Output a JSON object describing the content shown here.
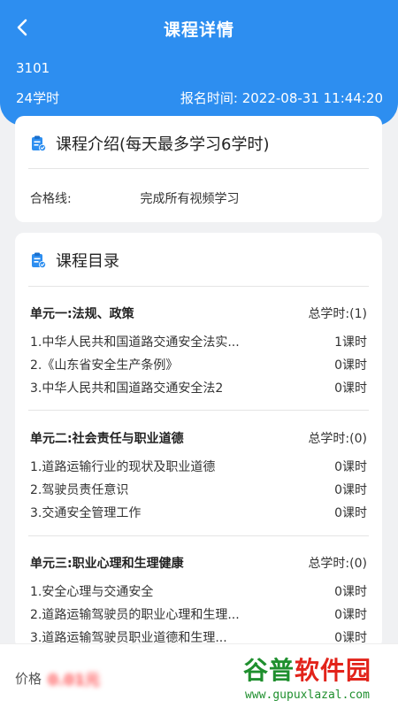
{
  "nav": {
    "title": "课程详情"
  },
  "header": {
    "course_code": "3101",
    "hours": "24学时",
    "enroll_label": "报名时间:",
    "enroll_time": "2022-08-31 11:44:20"
  },
  "intro": {
    "title": "课程介绍(每天最多学习6学时)",
    "pass_label": "合格线:",
    "pass_value": "完成所有视频学习"
  },
  "catalog": {
    "title": "课程目录",
    "units": [
      {
        "title": "单元一:法规、政策",
        "total": "总学时:(1)",
        "lessons": [
          {
            "name": "1.中华人民共和国道路交通安全法实...",
            "hours": "1课时"
          },
          {
            "name": "2.《山东省安全生产条例》",
            "hours": "0课时"
          },
          {
            "name": "3.中华人民共和国道路交通安全法2",
            "hours": "0课时"
          }
        ]
      },
      {
        "title": "单元二:社会责任与职业道德",
        "total": "总学时:(0)",
        "lessons": [
          {
            "name": "1.道路运输行业的现状及职业道德",
            "hours": "0课时"
          },
          {
            "name": "2.驾驶员责任意识",
            "hours": "0课时"
          },
          {
            "name": "3.交通安全管理工作",
            "hours": "0课时"
          }
        ]
      },
      {
        "title": "单元三:职业心理和生理健康",
        "total": "总学时:(0)",
        "lessons": [
          {
            "name": "1.安全心理与交通安全",
            "hours": "0课时"
          },
          {
            "name": "2.道路运输驾驶员的职业心理和生理...",
            "hours": "0课时"
          },
          {
            "name": "3.道路运输驾驶员职业道德和生理...",
            "hours": "0课时"
          }
        ]
      }
    ]
  },
  "bottom": {
    "price_label": "价格",
    "price_value": "0.01元"
  },
  "watermark": {
    "brand_a": "谷普",
    "brand_b": "软件园",
    "url": "www.gupuxlazal.com"
  },
  "colors": {
    "primary": "#2d8ef0",
    "price": "#ff4d4f"
  },
  "icons": {
    "back": "chevron-left-icon",
    "section": "clipboard-check-icon"
  }
}
